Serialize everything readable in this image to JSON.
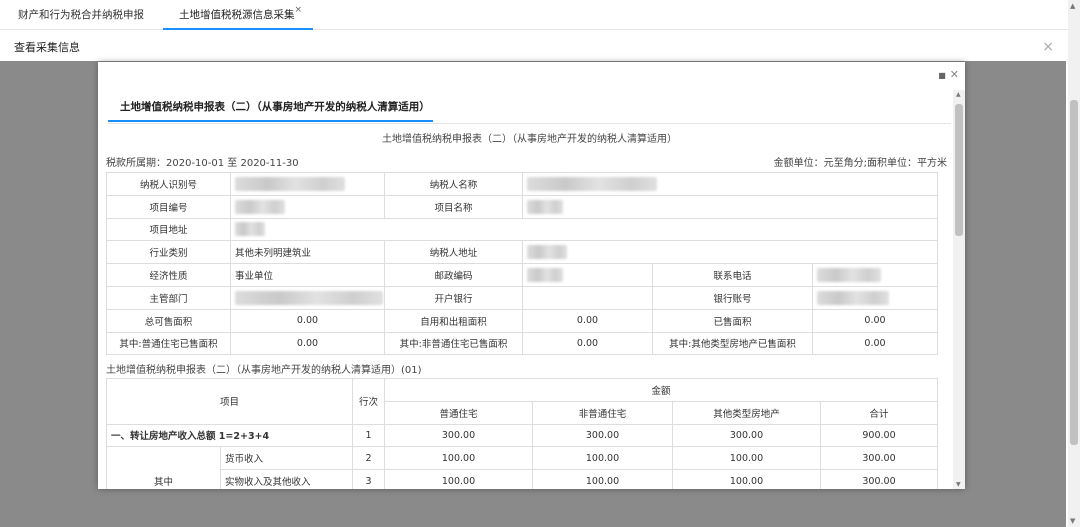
{
  "tabs": [
    {
      "label": "财产和行为税合并纳税申报"
    },
    {
      "label": "土地增值税税源信息采集",
      "close": "×"
    }
  ],
  "panel": {
    "title": "查看采集信息",
    "close": "×"
  },
  "modal": {
    "tab_label": "土地增值税纳税申报表（二）（从事房地产开发的纳税人清算适用）",
    "form_title": "土地增值税纳税申报表（二）（从事房地产开发的纳税人清算适用）",
    "period": "税款所属期：2020-10-01 至 2020-11-30",
    "unit": "金额单位：元至角分;面积单位：平方米",
    "info": {
      "taxpayer_id_label": "纳税人识别号",
      "taxpayer_name_label": "纳税人名称",
      "project_no_label": "项目编号",
      "project_name_label": "项目名称",
      "project_addr_label": "项目地址",
      "industry_label": "行业类别",
      "industry_value": "其他未列明建筑业",
      "taxpayer_addr_label": "纳税人地址",
      "econ_label": "经济性质",
      "econ_value": "事业单位",
      "postcode_label": "邮政编码",
      "phone_label": "联系电话",
      "dept_label": "主管部门",
      "bank_label": "开户银行",
      "account_label": "银行账号",
      "saleable_label": "总可售面积",
      "saleable_value": "0.00",
      "selfuse_label": "自用和出租面积",
      "selfuse_value": "0.00",
      "sold_label": "已售面积",
      "sold_value": "0.00",
      "normal_sold_label": "其中:普通住宅已售面积",
      "normal_sold_value": "0.00",
      "nonnormal_sold_label": "其中:非普通住宅已售面积",
      "nonnormal_sold_value": "0.00",
      "other_sold_label": "其中:其他类型房地产已售面积",
      "other_sold_value": "0.00"
    },
    "subtable": {
      "title": "土地增值税纳税申报表（二）（从事房地产开发的纳税人清算适用）(01)",
      "headers": {
        "item": "项目",
        "line": "行次",
        "amount": "金额",
        "normal": "普通住宅",
        "nonnormal": "非普通住宅",
        "other": "其他类型房地产",
        "total": "合计"
      },
      "rows": [
        {
          "item": "一、转让房地产收入总额 1=2+3+4",
          "line": "1",
          "values": [
            "300.00",
            "300.00",
            "300.00",
            "900.00"
          ]
        },
        {
          "group": "其中",
          "item": "货币收入",
          "line": "2",
          "values": [
            "100.00",
            "100.00",
            "100.00",
            "300.00"
          ]
        },
        {
          "item": "实物收入及其他收入",
          "line": "3",
          "values": [
            "100.00",
            "100.00",
            "100.00",
            "300.00"
          ]
        }
      ]
    }
  }
}
